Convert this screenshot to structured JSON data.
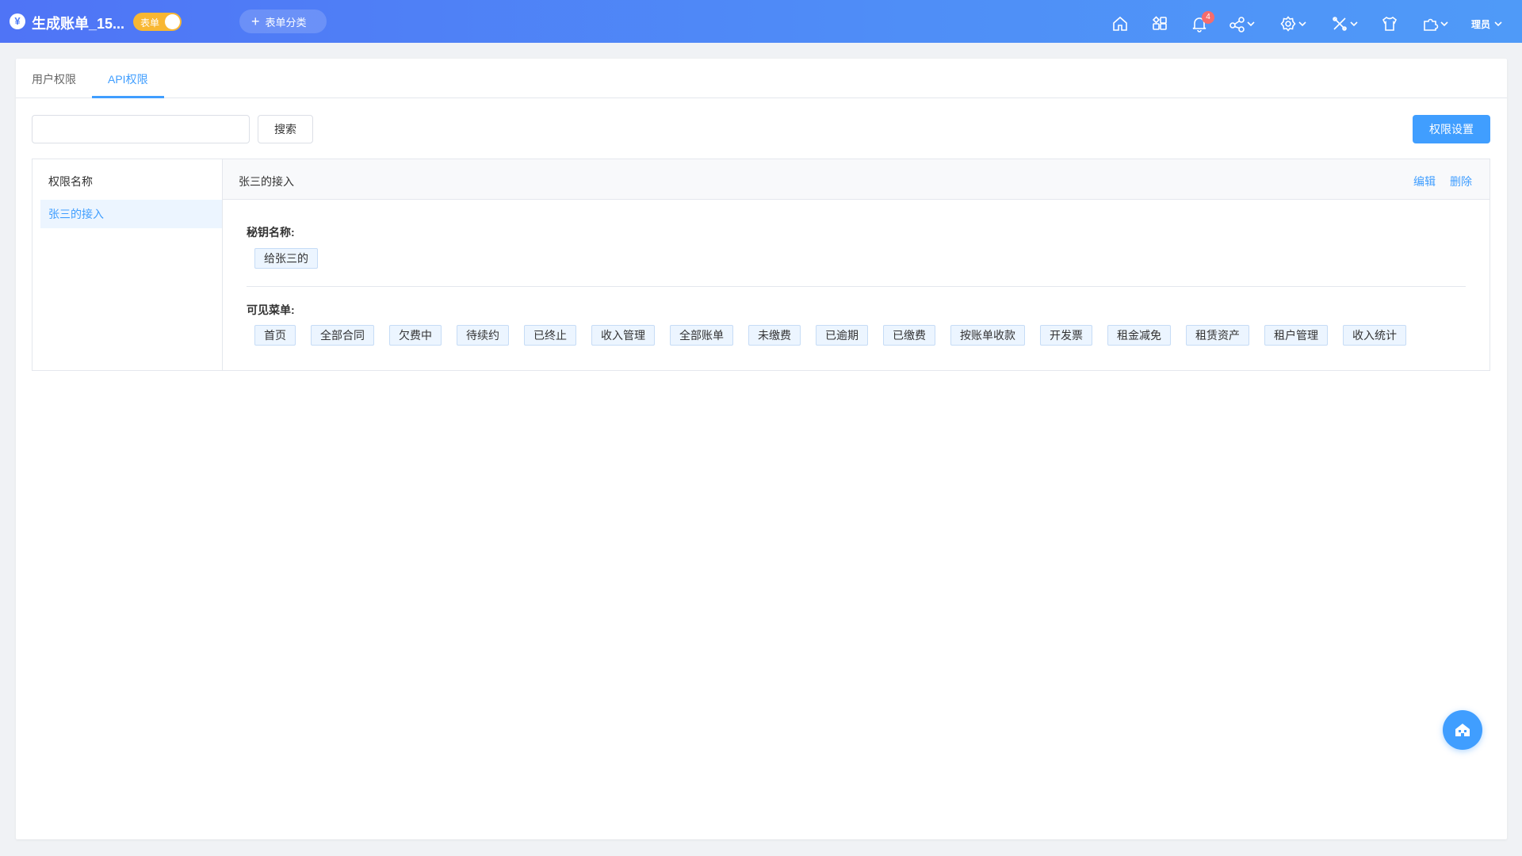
{
  "topbar": {
    "app_logo_glyph": "¥",
    "app_title": "生成账单_15...",
    "toggle_label": "表单",
    "add_category_label": "表单分类",
    "notification_count": "4",
    "user_label": "理员",
    "icons": [
      "home-icon",
      "grid-apps-icon",
      "bell-icon",
      "share-icon",
      "settings-icon",
      "tools-icon",
      "shirt-icon",
      "plugin-icon"
    ]
  },
  "tabs": [
    {
      "label": "用户权限",
      "active": false
    },
    {
      "label": "API权限",
      "active": true
    }
  ],
  "toolbar": {
    "search_value": "",
    "search_placeholder": "",
    "search_label": "搜索",
    "permission_settings_label": "权限设置"
  },
  "list": {
    "header": "权限名称",
    "items": [
      {
        "label": "张三的接入",
        "selected": true
      }
    ]
  },
  "detail": {
    "title": "张三的接入",
    "edit_label": "编辑",
    "delete_label": "删除",
    "key_section_label": "秘钥名称:",
    "key_tags": [
      "给张三的"
    ],
    "menu_section_label": "可见菜单:",
    "menu_tags": [
      "首页",
      "全部合同",
      "欠费中",
      "待续约",
      "已终止",
      "收入管理",
      "全部账单",
      "未缴费",
      "已逾期",
      "已缴费",
      "按账单收款",
      "开发票",
      "租金减免",
      "租赁资产",
      "租户管理",
      "收入统计"
    ]
  },
  "colors": {
    "accent": "#409eff",
    "topbar_gradient_start": "#4f74f6",
    "topbar_gradient_end": "#4f9af8",
    "toggle": "#f8b733",
    "badge": "#f56c6c"
  }
}
